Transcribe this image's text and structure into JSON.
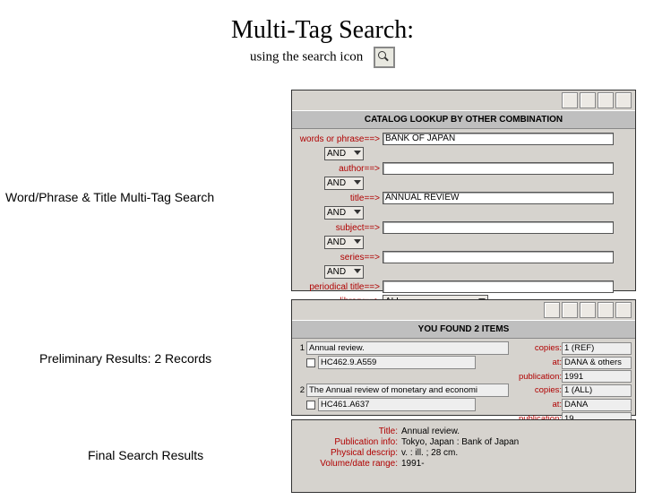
{
  "title": "Multi-Tag Search:",
  "subtitle": "using the search icon",
  "labels": {
    "section1": "Word/Phrase & Title Multi-Tag Search",
    "section2": "Preliminary Results: 2 Records",
    "section3": "Final Search Results"
  },
  "panel1": {
    "header": "CATALOG LOOKUP BY OTHER COMBINATION",
    "fields": {
      "words_label": "words or phrase==>",
      "words_value": "BANK OF JAPAN",
      "author_label": "author==>",
      "author_value": "",
      "title_label": "title==>",
      "title_value": "ANNUAL REVIEW",
      "subject_label": "subject==>",
      "subject_value": "",
      "series_label": "series==>",
      "series_value": "",
      "periodical_label": "periodical title==>",
      "periodical_value": "",
      "library_label": "library==>",
      "library_value": "ALL"
    },
    "op": "AND"
  },
  "panel2": {
    "header": "YOU FOUND 2 ITEMS",
    "results": [
      {
        "n": "1",
        "title": "Annual review.",
        "call": "HC462.9.A559",
        "copies": "1 (REF)",
        "at": "DANA & others",
        "pub": "1991"
      },
      {
        "n": "2",
        "title": "The Annual review of monetary and economi",
        "call": "HC461.A637",
        "copies": "1 (ALL)",
        "at": "DANA",
        "pub": "19"
      }
    ],
    "meta_labels": {
      "copies": "copies:",
      "at": "at:",
      "pub": "publication:"
    }
  },
  "panel3": {
    "rows": [
      {
        "l": "Title:",
        "v": "Annual review."
      },
      {
        "l": "Publication info:",
        "v": "Tokyo, Japan : Bank of Japan"
      },
      {
        "l": "Physical descrip:",
        "v": "v. : ill. ; 28 cm."
      },
      {
        "l": "Volume/date range:",
        "v": "1991-"
      }
    ]
  }
}
